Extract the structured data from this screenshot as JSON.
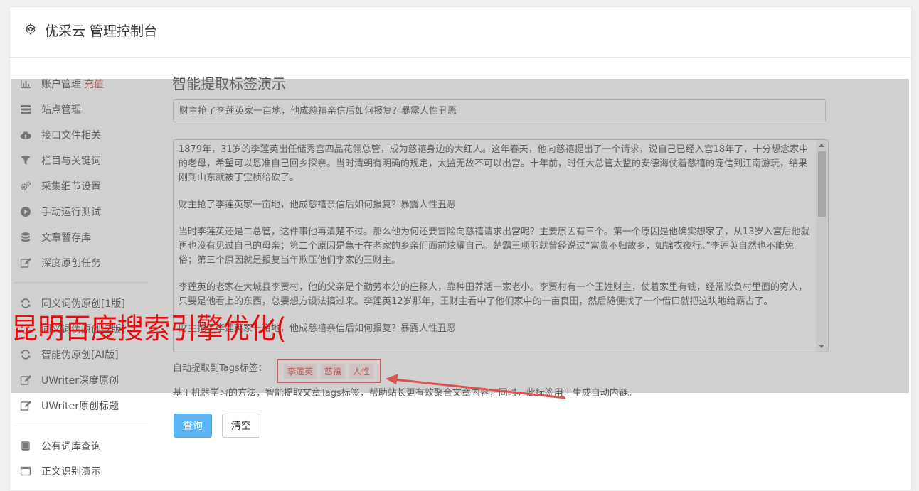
{
  "header": {
    "title": "优采云 管理控制台"
  },
  "sidebar": {
    "items": [
      {
        "label": "账户管理",
        "badge": "充值",
        "icon": "bar-chart-icon"
      },
      {
        "label": "站点管理",
        "icon": "server-icon"
      },
      {
        "label": "接口文件相关",
        "icon": "cloud-upload-icon"
      },
      {
        "label": "栏目与关键词",
        "icon": "filter-icon"
      },
      {
        "label": "采集细节设置",
        "icon": "gears-icon"
      },
      {
        "label": "手动运行测试",
        "icon": "play-circle-icon"
      },
      {
        "label": "文章暂存库",
        "icon": "database-icon"
      },
      {
        "label": "深度原创任务",
        "icon": "edit-icon"
      },
      {
        "label": "同义词伪原创[1版]",
        "icon": "refresh-icon"
      },
      {
        "label": "同义词伪原创[2版]",
        "icon": "refresh-icon"
      },
      {
        "label": "智能伪原创[AI版]",
        "icon": "refresh-icon"
      },
      {
        "label": "UWriter深度原创",
        "icon": "edit-icon"
      },
      {
        "label": "UWriter原创标题",
        "icon": "edit-icon"
      },
      {
        "label": "公有词库查询",
        "icon": "book-icon"
      },
      {
        "label": "正文识别演示",
        "icon": "window-icon"
      }
    ]
  },
  "main": {
    "section_title": "智能提取标签演示",
    "title_value": "财主抢了李莲英家一亩地，他成慈禧亲信后如何报复？暴露人性丑恶",
    "paragraphs": [
      "1879年，31岁的李莲英出任储秀宫四品花翎总管，成为慈禧身边的大红人。这年春天，他向慈禧提出了一个请求，说自己已经入宫18年了，十分想念家中的老母，希望可以恩准自己回乡探亲。当时清朝有明确的规定，太监无故不可以出宫。十年前，时任大总管太监的安德海仗着慈禧的宠信到江南游玩，结果刚到山东就被丁宝桢给砍了。",
      "财主抢了李莲英家一亩地，他成慈禧亲信后如何报复？暴露人性丑恶",
      "当时李莲英还是二总管，这件事他再清楚不过。那么他为何还要冒险向慈禧请求出宫呢？主要原因有三个。第一个原因是他确实想家了，从13岁入宫后他就再也没有见过自己的母亲；第二个原因是急于在老家的乡亲们面前炫耀自己。楚霸王项羽就曾经说过“富贵不归故乡，如锦衣夜行。”李莲英自然也不能免俗；第三个原因就是报复当年欺压他们李家的王财主。",
      "李莲英的老家在大城县李贾村，他的父亲是个勤劳本分的庄稼人，靠种田养活一家老小。李贾村有一个王姓财主，仗着家里有钱，经常欺负村里面的穷人，只要是他看上的东西，总要想方设法搞过来。李莲英12岁那年，王财主看中了他们家中的一亩良田，然后随便找了一个借口就把这块地给霸占了。",
      "财主抢了李莲英家一亩地，他成慈禧亲信后如何报复？暴露人性丑恶"
    ],
    "tags_label": "自动提取到Tags标签：",
    "tags": [
      "李莲英",
      "慈禧",
      "人性"
    ],
    "description": "基于机器学习的方法，智能提取文章Tags标签，帮助站长更有效聚合文章内容，同时，此标签用于生成自动内链。",
    "query_button": "查询",
    "clear_button": "清空"
  },
  "watermark": "昆明百度搜索引擎优化(",
  "colors": {
    "primary": "#5bb5f4",
    "danger": "#d9534f",
    "watermark": "#e50f0f"
  }
}
